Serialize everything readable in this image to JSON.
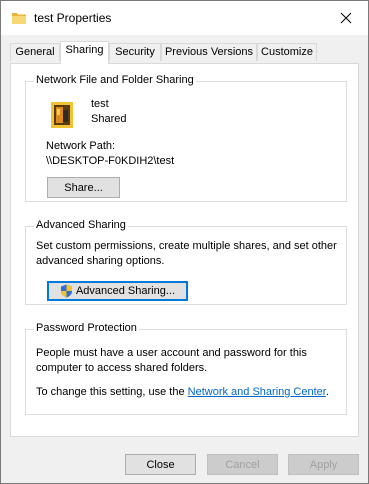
{
  "window": {
    "title": "test Properties"
  },
  "tabs": [
    {
      "label": "General"
    },
    {
      "label": "Sharing"
    },
    {
      "label": "Security"
    },
    {
      "label": "Previous Versions"
    },
    {
      "label": "Customize"
    }
  ],
  "active_tab": "Sharing",
  "network_sharing": {
    "group_title": "Network File and Folder Sharing",
    "folder_name": "test",
    "folder_status": "Shared",
    "path_label": "Network Path:",
    "path_value": "\\\\DESKTOP-F0KDIH2\\test",
    "share_button": "Share..."
  },
  "advanced_sharing": {
    "group_title": "Advanced Sharing",
    "description_line1": "Set custom permissions, create multiple shares, and set other",
    "description_line2": "advanced sharing options.",
    "button": "Advanced Sharing..."
  },
  "password_protection": {
    "group_title": "Password Protection",
    "description_line1": "People must have a user account and password for this",
    "description_line2": "computer to access shared folders.",
    "change_prefix": "To change this setting, use the ",
    "link": "Network and Sharing Center",
    "change_suffix": "."
  },
  "footer": {
    "close": "Close",
    "cancel": "Cancel",
    "apply": "Apply"
  },
  "colors": {
    "accent": "#0078d7",
    "link": "#0066cc",
    "folder": "#f5c342"
  }
}
